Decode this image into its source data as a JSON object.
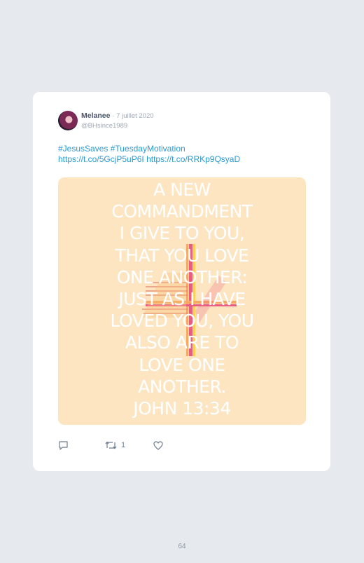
{
  "tweet": {
    "author_name": "Melanee",
    "separator": "·",
    "date": "7 juillet 2020",
    "handle": "@BHsince1989",
    "hashtags": [
      "#JesusSaves",
      "#TuesdayMotivation"
    ],
    "links": [
      "https://t.co/5GcjP5uP6I",
      "https://t.co/RRKp9QsyaD"
    ],
    "media": {
      "verse_lines": [
        "A NEW",
        "COMMANDMENT",
        "I GIVE TO YOU,",
        "THAT YOU LOVE",
        "ONE ANOTHER:",
        "JUST AS I HAVE",
        "LOVED YOU, YOU",
        "ALSO ARE TO",
        "LOVE ONE",
        "ANOTHER.",
        "JOHN 13:34"
      ],
      "background_color": "#fce5c0",
      "text_color": "#ffffff",
      "art": "cross-icon"
    },
    "actions": {
      "reply_count": "",
      "retweet_count": "1",
      "like_count": ""
    }
  },
  "page": {
    "number": "64"
  },
  "colors": {
    "link": "#2b9ad3",
    "icon": "#6b7a8c"
  }
}
